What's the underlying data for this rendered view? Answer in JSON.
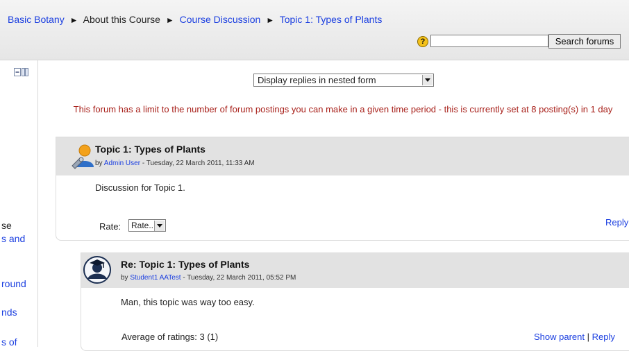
{
  "breadcrumb": {
    "items": [
      "Basic Botany",
      "About this Course",
      "Course Discussion",
      "Topic 1: Types of Plants"
    ],
    "separator": "►"
  },
  "search": {
    "help_icon": "?",
    "input_value": "",
    "button_label": "Search forums"
  },
  "sidebar": {
    "fragments": [
      "se",
      "s and",
      "round",
      "nds",
      "s of"
    ]
  },
  "display_mode": {
    "selected": "Display replies in nested form"
  },
  "notice": "This forum has a limit to the number of forum postings you can make in a given time period - this is currently set at 8 posting(s) in 1 day",
  "posts": [
    {
      "title": "Topic 1: Types of Plants",
      "by_prefix": "by ",
      "author": "Admin User",
      "date": " - Tuesday, 22 March 2011, 11:33 AM",
      "body": "Discussion for Topic 1.",
      "rate_label": "Rate:",
      "rate_selected": "Rate...",
      "reply": "Reply",
      "avatar": "admin-user-avatar"
    },
    {
      "title": "Re: Topic 1: Types of Plants",
      "by_prefix": "by ",
      "author": "Student1 AATest",
      "date": " - Tuesday, 22 March 2011, 05:52 PM",
      "body": "Man, this topic was way too easy.",
      "average": "Average of ratings: 3 (1)",
      "show_parent": "Show parent",
      "divider": " | ",
      "reply": "Reply",
      "avatar": "student-avatar"
    }
  ],
  "colors": {
    "link": "#1a3ee0",
    "notice": "#a8201a",
    "post_header": "#e2e2e2"
  }
}
